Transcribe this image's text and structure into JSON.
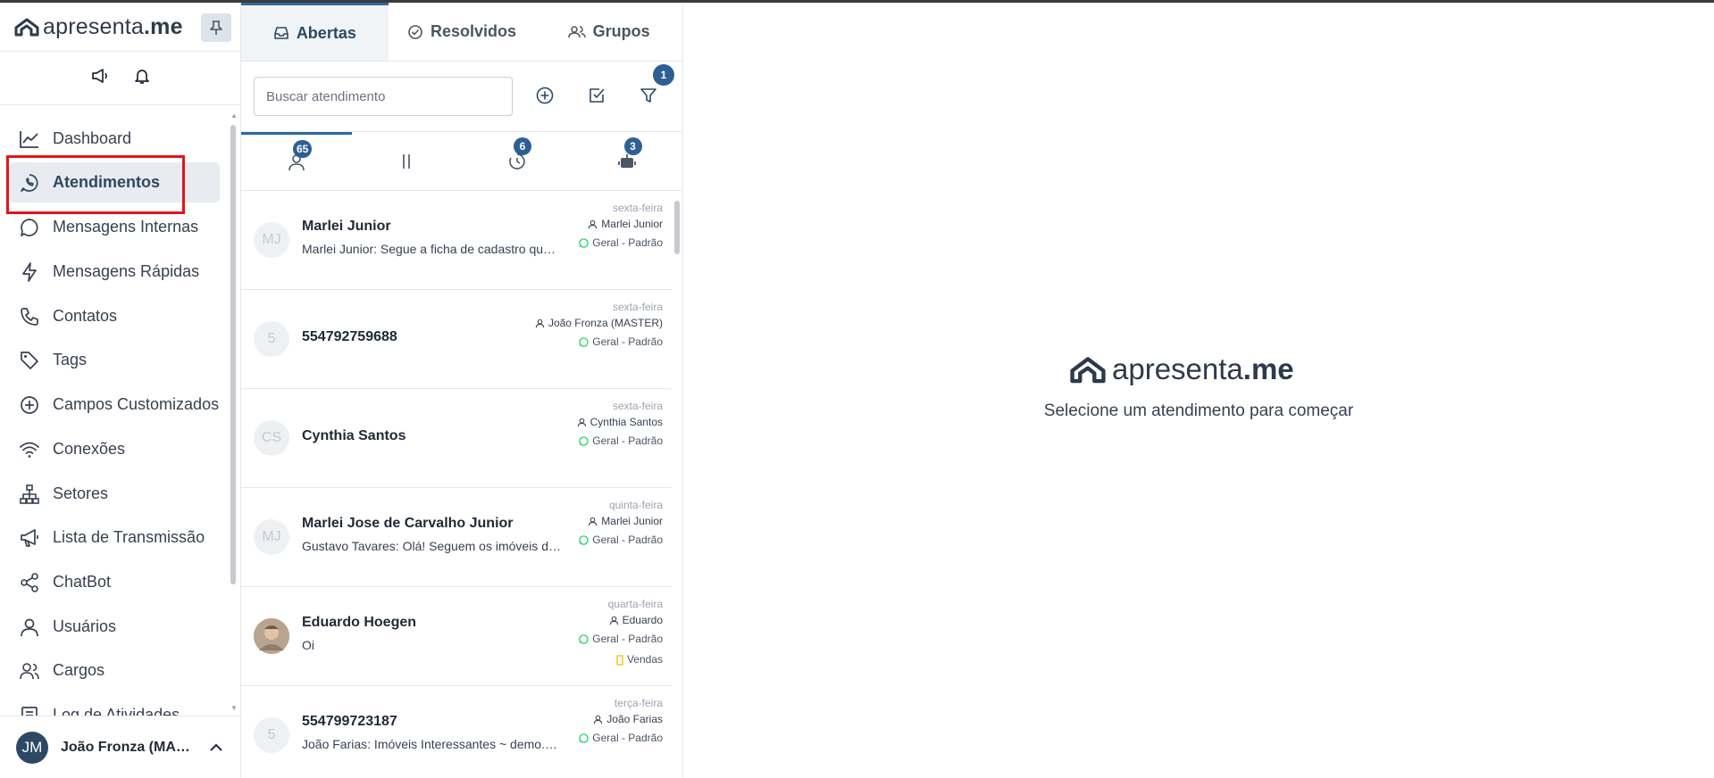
{
  "brand": {
    "name_a": "apresenta",
    "name_b": ".me"
  },
  "sidebar": {
    "items": [
      {
        "label": "Dashboard"
      },
      {
        "label": "Atendimentos"
      },
      {
        "label": "Mensagens Internas"
      },
      {
        "label": "Mensagens Rápidas"
      },
      {
        "label": "Contatos"
      },
      {
        "label": "Tags"
      },
      {
        "label": "Campos Customizados"
      },
      {
        "label": "Conexões"
      },
      {
        "label": "Setores"
      },
      {
        "label": "Lista de Transmissão"
      },
      {
        "label": "ChatBot"
      },
      {
        "label": "Usuários"
      },
      {
        "label": "Cargos"
      },
      {
        "label": "Log de Atividades"
      }
    ],
    "user": {
      "initials": "JM",
      "name": "João Fronza (MASTER)"
    }
  },
  "tabs": [
    {
      "label": "Abertas"
    },
    {
      "label": "Resolvidos"
    },
    {
      "label": "Grupos"
    }
  ],
  "search": {
    "placeholder": "Buscar atendimento",
    "filter_badge": "1"
  },
  "subtabs": {
    "open_count": "65",
    "pending_count": "6",
    "bot_count": "3"
  },
  "tickets": [
    {
      "initials": "MJ",
      "name": "Marlei Junior",
      "message": "Marlei Junior: Segue a ficha de cadastro que preencheu",
      "day": "sexta-feira",
      "user": "Marlei Junior",
      "connection": "Geral - Padrão"
    },
    {
      "initials": "5",
      "name": "554792759688",
      "message": "",
      "day": "sexta-feira",
      "user": "João Fronza (MASTER)",
      "connection": "Geral - Padrão"
    },
    {
      "initials": "CS",
      "name": "Cynthia Santos",
      "message": "",
      "day": "sexta-feira",
      "user": "Cynthia Santos",
      "connection": "Geral - Padrão"
    },
    {
      "initials": "MJ",
      "name": "Marlei Jose de Carvalho Junior",
      "message": "Gustavo Tavares: Olá! Seguem os imóveis de seu interesse",
      "day": "quinta-feira",
      "user": "Marlei Junior",
      "connection": "Geral - Padrão"
    },
    {
      "initials": "",
      "name": "Eduardo Hoegen",
      "message": "Oi",
      "day": "quarta-feira",
      "user": "Eduardo",
      "connection": "Geral - Padrão",
      "sector": "Vendas"
    },
    {
      "initials": "5",
      "name": "554799723187",
      "message": "João Farias: Imóveis Interessantes ~ demo.apresenta.me",
      "day": "terça-feira",
      "user": "João Farias",
      "connection": "Geral - Padrão"
    }
  ],
  "main": {
    "prompt": "Selecione um atendimento para começar"
  },
  "colors": {
    "brand": "#2d3a4b",
    "accent": "#2d5f93",
    "highlight": "#e3141b",
    "whatsapp": "#25d366"
  }
}
